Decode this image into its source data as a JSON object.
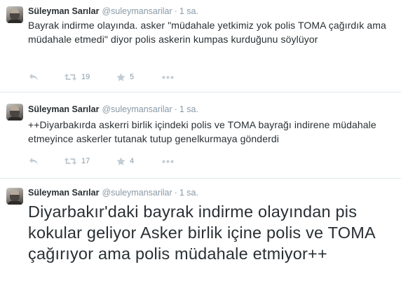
{
  "tweets": [
    {
      "name": "Süleyman Sarılar",
      "handle": "@suleymansarilar",
      "separator": "·",
      "time": "1 sa.",
      "text": "Bayrak indirme olayında. asker \"müdahale yetkimiz yok polis TOMA çağırdık ama müdahale etmedi\" diyor polis askerin kumpas kurduğunu söylüyor",
      "retweets": "19",
      "favorites": "5",
      "icons": [
        "reply-icon",
        "retweet-icon",
        "favorite-star-icon",
        "more-dots-icon"
      ]
    },
    {
      "name": "Süleyman Sarılar",
      "handle": "@suleymansarilar",
      "separator": "·",
      "time": "1 sa.",
      "text": "++Diyarbakırda askerri birlik içindeki polis ve TOMA bayrağı indirene müdahale etmeyince askerler tutanak tutup genelkurmaya gönderdi",
      "retweets": "17",
      "favorites": "4",
      "icons": [
        "reply-icon",
        "retweet-icon",
        "favorite-star-icon",
        "more-dots-icon"
      ]
    },
    {
      "name": "Süleyman Sarılar",
      "handle": "@suleymansarilar",
      "separator": "·",
      "time": "1 sa.",
      "text": "Diyarbakır'daki bayrak indirme olayından pis kokular geliyor Asker birlik içine polis ve TOMA  çağırıyor ama polis müdahale etmiyor++"
    }
  ],
  "colors": {
    "text": "#292f33",
    "muted": "#8899a6",
    "icon": "#9aa8b4",
    "divider": "#e1e8ed",
    "background": "#ffffff"
  }
}
